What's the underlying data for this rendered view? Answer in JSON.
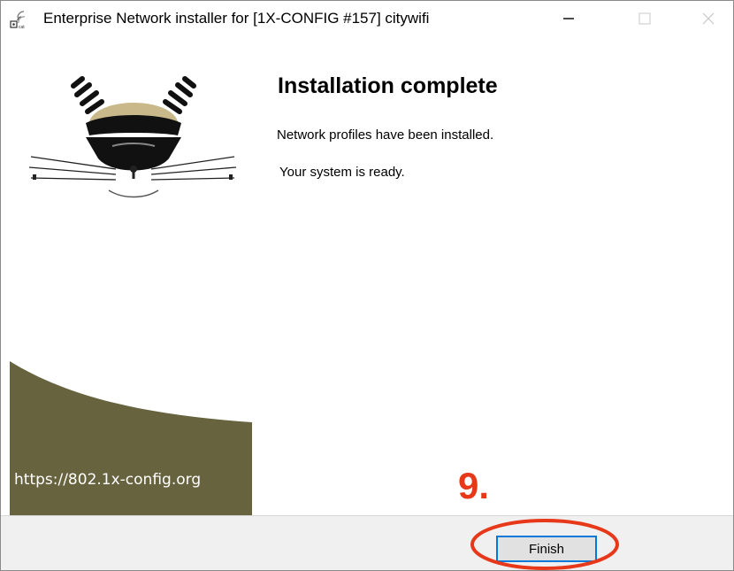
{
  "window": {
    "title": "Enterprise Network installer for [1X-CONFIG #157] citywifi",
    "icon": "wifi-installer-icon"
  },
  "controls": {
    "minimize_icon": "minimize-icon",
    "maximize_icon": "maximize-icon",
    "close_icon": "close-icon"
  },
  "banner": {
    "logo": "cat-logo",
    "url": "https://802.1x-config.org",
    "accent_color": "#67633f"
  },
  "content": {
    "heading": "Installation complete",
    "message": "Network profiles have been installed.",
    "status": "Your system is ready."
  },
  "annotation": {
    "step": "9.",
    "color": "#e8381a"
  },
  "footer": {
    "finish_label": "Finish"
  }
}
